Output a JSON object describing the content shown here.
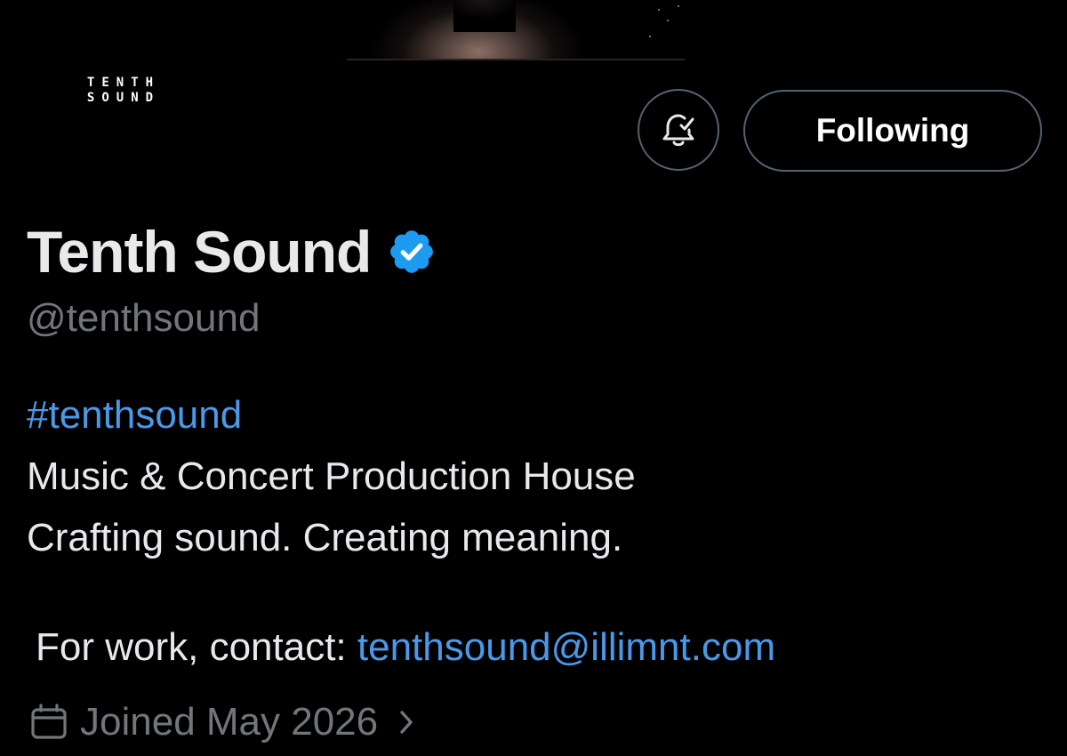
{
  "banner": {
    "icon": "banner-photo"
  },
  "avatar": {
    "line1": "TENTH",
    "line2": "SOUND"
  },
  "actions": {
    "notification_icon": "bell-check-icon",
    "follow_label": "Following"
  },
  "profile": {
    "display_name": "Tenth Sound",
    "verified_icon": "verified-badge-icon",
    "handle": "@tenthsound",
    "bio": {
      "hashtag": "#tenthsound",
      "line1": "Music & Concert Production House",
      "line2": "Crafting sound. Creating meaning.",
      "contact_prefix": "For work, contact: ",
      "contact_email": "tenthsound@illimnt.com"
    },
    "joined": {
      "icon": "calendar-icon",
      "text": "Joined May 2026",
      "chevron_icon": "chevron-right-icon"
    }
  },
  "colors": {
    "background": "#000000",
    "primary_text": "#e7e9ea",
    "secondary_text": "#71767b",
    "link": "#4a99e9",
    "verified": "#1d9bf0",
    "border": "#536471"
  }
}
